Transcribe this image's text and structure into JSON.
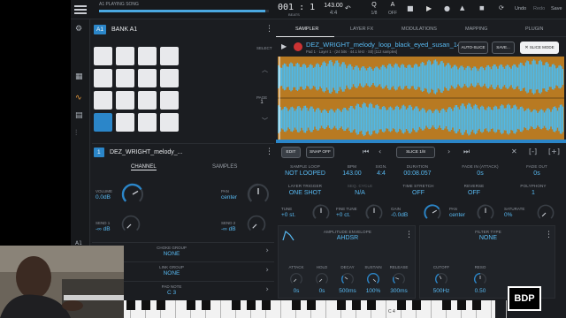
{
  "topbar": {
    "song_label": "A1 PLAYING SONG",
    "song_progress": 0.98,
    "position": "001 : 1",
    "position_sub": "BEATS",
    "bpm": "143.00",
    "signature": "4:4",
    "q_label": "Q",
    "q_value": "1/8",
    "ab_label": "A",
    "ab_value": "OFF",
    "undo": "Undo",
    "redo": "Redo",
    "save": "Save"
  },
  "bank": {
    "badge": "A1",
    "title": "BANK A1",
    "select_label": "SELECT",
    "page_label": "PAGE",
    "page_value": "1"
  },
  "track": {
    "number": "1",
    "name": "DEZ_WRIGHT_melody_..."
  },
  "left_tabs": [
    "CHANNEL",
    "SAMPLES"
  ],
  "channel": {
    "volume_label": "VOLUME",
    "volume_value": "0.0dB",
    "volume_level": 0.72,
    "pan_label": "PAN",
    "pan_value": "center",
    "pan_level": 0.5,
    "send1_label": "SEND 1",
    "send1_value": "-∞ dB",
    "send2_label": "SEND 2",
    "send2_value": "-∞ dB"
  },
  "channel_rows": [
    {
      "label": "CHOKE GROUP",
      "value": "NONE"
    },
    {
      "label": "LINK GROUP",
      "value": "NONE"
    },
    {
      "label": "PAD NOTE",
      "value": "C 3"
    }
  ],
  "right_tabs": [
    "SAMPLER",
    "LAYER FX",
    "MODULATIONS",
    "MAPPING",
    "PLUGIN"
  ],
  "sample": {
    "name": "DEZ_WRIGHT_melody_loop_black_eyed_susan_14...",
    "sub": "Pad 1 · Layer 1 · (24 bits · 44.1 kHz · Stl) [112 samples]",
    "auto_slice": "AUTO-SLICE",
    "save": "SAVE...",
    "slice_mode": "SLICE MODE"
  },
  "editbar": {
    "edit": "EDIT",
    "snap": "SNAP OFF",
    "slice": "SLICE 1/8"
  },
  "params_row1": [
    {
      "label": "SAMPLE LOOP",
      "value": "NOT LOOPED"
    },
    {
      "label": "BPM",
      "value": "143.00"
    },
    {
      "label": "SIGN.",
      "value": "4:4"
    },
    {
      "label": "DURATION",
      "value": "00:08.057"
    },
    {
      "label": "FADE IN (ATTACK)",
      "value": "0s"
    },
    {
      "label": "FADE OUT",
      "value": "0s"
    }
  ],
  "params_row2": [
    {
      "label": "LAYER TRIGGER",
      "value": "ONE SHOT"
    },
    {
      "label": "SEQ. CYCLE",
      "value": "N/A"
    },
    {
      "label": "TIME STRETCH",
      "value": "OFF"
    },
    {
      "label": "REVERSE",
      "value": "OFF"
    },
    {
      "label": "POLYPHONY",
      "value": "1"
    }
  ],
  "params_row3": [
    {
      "label": "TUNE",
      "value": "+0 st."
    },
    {
      "label": "FINE TUNE",
      "value": "+0 ct."
    },
    {
      "label": "GAIN",
      "value": "-0.0dB"
    },
    {
      "label": "PAN",
      "value": "center"
    },
    {
      "label": "SATURATE",
      "value": "0%"
    }
  ],
  "amp_env": {
    "label": "AMPLITUDE ENVELOPE",
    "value": "AHDSR",
    "knobs": [
      {
        "label": "ATTACK",
        "value": "0s"
      },
      {
        "label": "HOLD",
        "value": "0s"
      },
      {
        "label": "DECAY",
        "value": "500ms"
      },
      {
        "label": "SUSTAIN",
        "value": "100%"
      },
      {
        "label": "RELEASE",
        "value": "300ms"
      }
    ]
  },
  "filter": {
    "label": "FILTER TYPE",
    "value": "NONE",
    "knobs": [
      {
        "label": "CUTOFF",
        "value": "500Hz"
      },
      {
        "label": "RESO",
        "value": "0.50"
      }
    ]
  },
  "keyboard": {
    "c3": "C 3",
    "c4": "C 4"
  },
  "logo": "BDP",
  "colors": {
    "accent": "#57b8f0",
    "knob": "#2b86c9",
    "waveform": "#4fb8e8",
    "waveform_bg": "#b87a22"
  }
}
